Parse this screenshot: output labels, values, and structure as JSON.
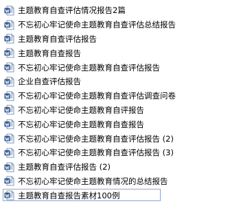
{
  "files": [
    {
      "name": "主题教育自查评估情况报告2篇",
      "icon": "word-doc-icon"
    },
    {
      "name": "不忘初心牢记使命主题教育自查评估总结报告",
      "icon": "word-doc-icon"
    },
    {
      "name": "主题教育自查评估报告",
      "icon": "word-doc-icon"
    },
    {
      "name": "主题教育自查报告",
      "icon": "word-doc-icon"
    },
    {
      "name": "不忘初心牢记使命主题教育自查评估报告",
      "icon": "word-doc-icon"
    },
    {
      "name": "企业自查评估报告",
      "icon": "word-doc-icon"
    },
    {
      "name": "不忘初心牢记使命主题教育自查评估调查问卷",
      "icon": "word-doc-icon"
    },
    {
      "name": "不忘初心牢记使命主题教育自评报告",
      "icon": "word-doc-icon"
    },
    {
      "name": "不忘初心牢记使命主题教育自查报告",
      "icon": "word-doc-icon"
    },
    {
      "name": "不忘初心牢记使命主题教育自查评估报告 (2)",
      "icon": "word-doc-icon"
    },
    {
      "name": "不忘初心牢记使命主题教育自查评估报告 (3)",
      "icon": "word-doc-icon"
    },
    {
      "name": "主题教育自查评估报告 (2)",
      "icon": "word-doc-icon"
    },
    {
      "name": "不忘初心牢记使命主题教育情况的总结报告",
      "icon": "word-doc-icon"
    },
    {
      "name": "主题教育自查报告素材100例",
      "icon": "word-doc-icon"
    }
  ],
  "colors": {
    "icon_blue": "#2b5797",
    "icon_paper": "#ffffff",
    "icon_outline": "#7f93b3",
    "selection_border": "#8fa6c8"
  }
}
